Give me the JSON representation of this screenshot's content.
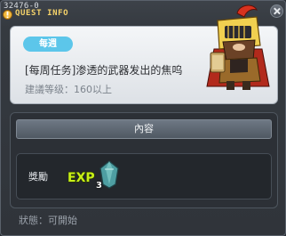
{
  "window": {
    "id_label": "32476-0",
    "title": "QUEST INFO"
  },
  "quest": {
    "badge": "每週",
    "name": "[每周任务]渗透的武器发出的焦呜",
    "level_requirement": "建議等级：160以上"
  },
  "content": {
    "section_label": "內容",
    "reward_label": "獎勵",
    "exp_label": "EXP",
    "item_count": "3"
  },
  "status": "狀態：可開始",
  "colors": {
    "title": "#f6d36a",
    "badge": "#5cc6ea",
    "exp_fill": "#c8f018",
    "gem": "#5aa8a8"
  },
  "icons": [
    "quest-icon",
    "close-icon",
    "npc-knight-portrait",
    "exp-icon",
    "gem-item-icon"
  ]
}
